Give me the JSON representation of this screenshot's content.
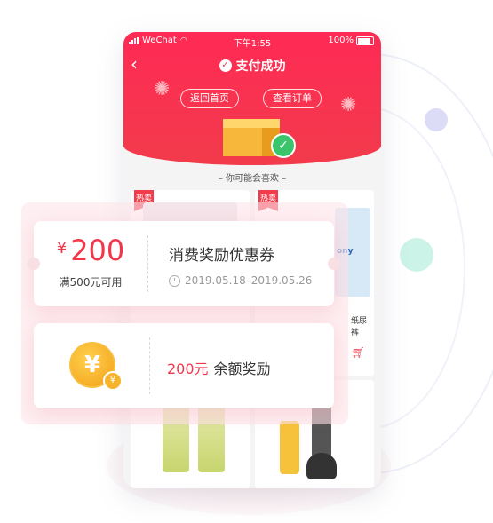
{
  "colors": {
    "primary": "#f23b4b",
    "success": "#3ac56d",
    "coin": "#f6b42c"
  },
  "status_bar": {
    "carrier": "WeChat",
    "time": "下午1:55",
    "battery": "100%"
  },
  "nav": {
    "title": "支付成功",
    "back_icon": "chevron-left-icon"
  },
  "actions": {
    "home_label": "返回首页",
    "order_label": "查看订单"
  },
  "recommend": {
    "title": "– 你可能会喜欢 –",
    "hot_tag": "热卖",
    "product_name": "纸尿裤",
    "diaper_brand": "ony"
  },
  "coupon": {
    "currency": "¥",
    "amount": "200",
    "condition": "满500元可用",
    "title": "消费奖励优惠券",
    "date_range": "2019.05.18–2019.05.26"
  },
  "reward": {
    "coin_symbol": "¥",
    "amount": "200元",
    "label": "余额奖励"
  }
}
